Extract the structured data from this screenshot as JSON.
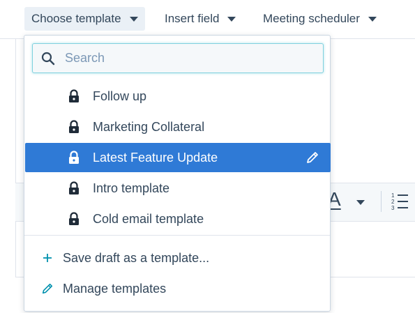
{
  "toolbar": {
    "choose_template": "Choose template",
    "insert_field": "Insert field",
    "meeting_scheduler": "Meeting scheduler"
  },
  "search": {
    "placeholder": "Search",
    "value": ""
  },
  "templates": [
    {
      "label": "Follow up",
      "icon": "lock-icon",
      "selected": false
    },
    {
      "label": "Marketing Collateral",
      "icon": "lock-icon",
      "selected": false
    },
    {
      "label": "Latest Feature Update",
      "icon": "lock-icon",
      "selected": true
    },
    {
      "label": "Intro template",
      "icon": "lock-icon",
      "selected": false
    },
    {
      "label": "Cold email template",
      "icon": "lock-icon",
      "selected": false
    }
  ],
  "actions": {
    "save_draft": "Save draft as a template...",
    "manage": "Manage templates"
  },
  "editor": {
    "font_color_glyph": "A"
  },
  "colors": {
    "accent": "#2f7ad6",
    "text": "#33475b",
    "link": "#0091ae"
  }
}
